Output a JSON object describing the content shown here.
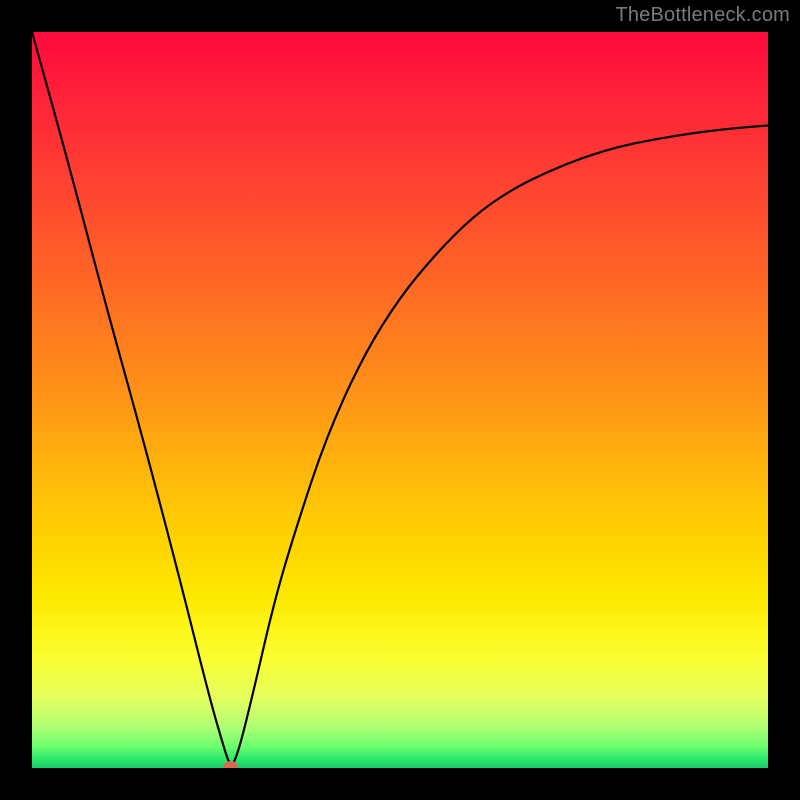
{
  "watermark": "TheBottleneck.com",
  "chart_data": {
    "type": "line",
    "title": "",
    "xlabel": "",
    "ylabel": "",
    "xlim": [
      0,
      100
    ],
    "ylim": [
      0,
      100
    ],
    "grid": false,
    "series": [
      {
        "name": "bottleneck-curve",
        "x": [
          0,
          5,
          10,
          15,
          20,
          24,
          26,
          27,
          28,
          30,
          33,
          36,
          40,
          45,
          50,
          55,
          60,
          65,
          70,
          75,
          80,
          85,
          90,
          95,
          100
        ],
        "values": [
          100,
          82,
          63,
          45,
          26,
          10,
          3,
          0,
          2,
          10,
          23,
          33,
          45,
          56,
          64,
          70,
          75,
          78.5,
          81,
          83,
          84.5,
          85.5,
          86.3,
          86.9,
          87.3
        ]
      }
    ],
    "marker_point": {
      "x": 27,
      "y": 0,
      "color": "#d86a50"
    },
    "background_gradient": {
      "stops": [
        {
          "pos": 0.0,
          "color": "#ff0a3c"
        },
        {
          "pos": 0.35,
          "color": "#ff6a24"
        },
        {
          "pos": 0.69,
          "color": "#ffd300"
        },
        {
          "pos": 0.9,
          "color": "#e8ff5a"
        },
        {
          "pos": 1.0,
          "color": "#18c96a"
        }
      ]
    }
  }
}
